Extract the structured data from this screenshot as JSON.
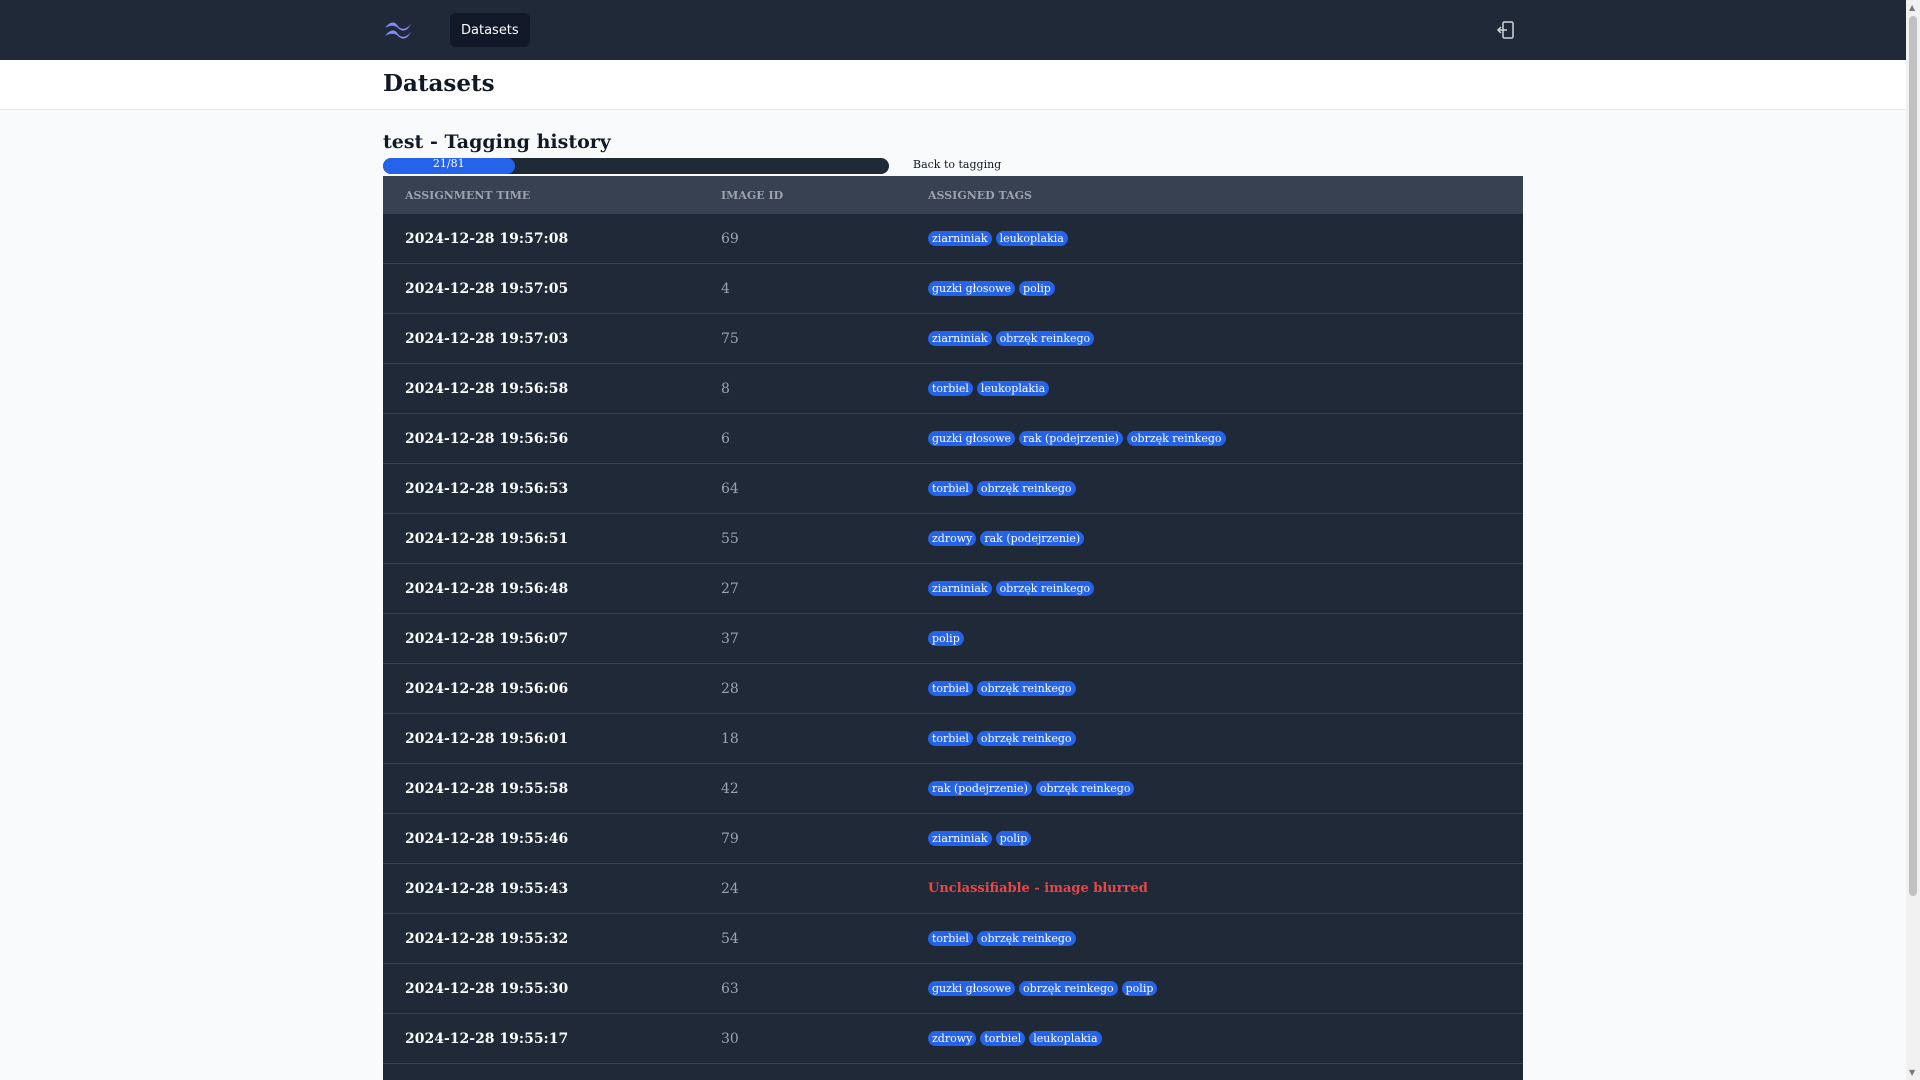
{
  "navbar": {
    "logo": "tailwind-logo-icon",
    "datasets_label": "Datasets",
    "logout_icon": "logout-icon"
  },
  "header": {
    "title": "Datasets"
  },
  "section": {
    "title": "test - Tagging history",
    "progress_text": "21/81",
    "progress_fraction": 0.26,
    "back_label": "Back to tagging"
  },
  "table": {
    "headers": [
      "Assignment time",
      "Image ID",
      "Assigned tags"
    ],
    "rows": [
      {
        "time": "2024-12-28 19:57:08",
        "id": "69",
        "tags": [
          "ziarniniak",
          "leukoplakia"
        ]
      },
      {
        "time": "2024-12-28 19:57:05",
        "id": "4",
        "tags": [
          "guzki głosowe",
          "polip"
        ]
      },
      {
        "time": "2024-12-28 19:57:03",
        "id": "75",
        "tags": [
          "ziarniniak",
          "obrzęk reinkego"
        ]
      },
      {
        "time": "2024-12-28 19:56:58",
        "id": "8",
        "tags": [
          "torbiel",
          "leukoplakia"
        ]
      },
      {
        "time": "2024-12-28 19:56:56",
        "id": "6",
        "tags": [
          "guzki głosowe",
          "rak (podejrzenie)",
          "obrzęk reinkego"
        ]
      },
      {
        "time": "2024-12-28 19:56:53",
        "id": "64",
        "tags": [
          "torbiel",
          "obrzęk reinkego"
        ]
      },
      {
        "time": "2024-12-28 19:56:51",
        "id": "55",
        "tags": [
          "zdrowy",
          "rak (podejrzenie)"
        ]
      },
      {
        "time": "2024-12-28 19:56:48",
        "id": "27",
        "tags": [
          "ziarniniak",
          "obrzęk reinkego"
        ]
      },
      {
        "time": "2024-12-28 19:56:07",
        "id": "37",
        "tags": [
          "polip"
        ]
      },
      {
        "time": "2024-12-28 19:56:06",
        "id": "28",
        "tags": [
          "torbiel",
          "obrzęk reinkego"
        ]
      },
      {
        "time": "2024-12-28 19:56:01",
        "id": "18",
        "tags": [
          "torbiel",
          "obrzęk reinkego"
        ]
      },
      {
        "time": "2024-12-28 19:55:58",
        "id": "42",
        "tags": [
          "rak (podejrzenie)",
          "obrzęk reinkego"
        ]
      },
      {
        "time": "2024-12-28 19:55:46",
        "id": "79",
        "tags": [
          "ziarniniak",
          "polip"
        ]
      },
      {
        "time": "2024-12-28 19:55:43",
        "id": "24",
        "tags": [],
        "note": "Unclassifiable - image blurred"
      },
      {
        "time": "2024-12-28 19:55:32",
        "id": "54",
        "tags": [
          "torbiel",
          "obrzęk reinkego"
        ]
      },
      {
        "time": "2024-12-28 19:55:30",
        "id": "63",
        "tags": [
          "guzki głosowe",
          "obrzęk reinkego",
          "polip"
        ]
      },
      {
        "time": "2024-12-28 19:55:17",
        "id": "30",
        "tags": [
          "zdrowy",
          "torbiel",
          "leukoplakia"
        ]
      }
    ]
  },
  "colors": {
    "navbar": "#1f2937",
    "table_bg": "#1f2937",
    "table_header": "#374151",
    "tag_bg": "#2563eb",
    "unclassifiable": "#ef4444"
  }
}
